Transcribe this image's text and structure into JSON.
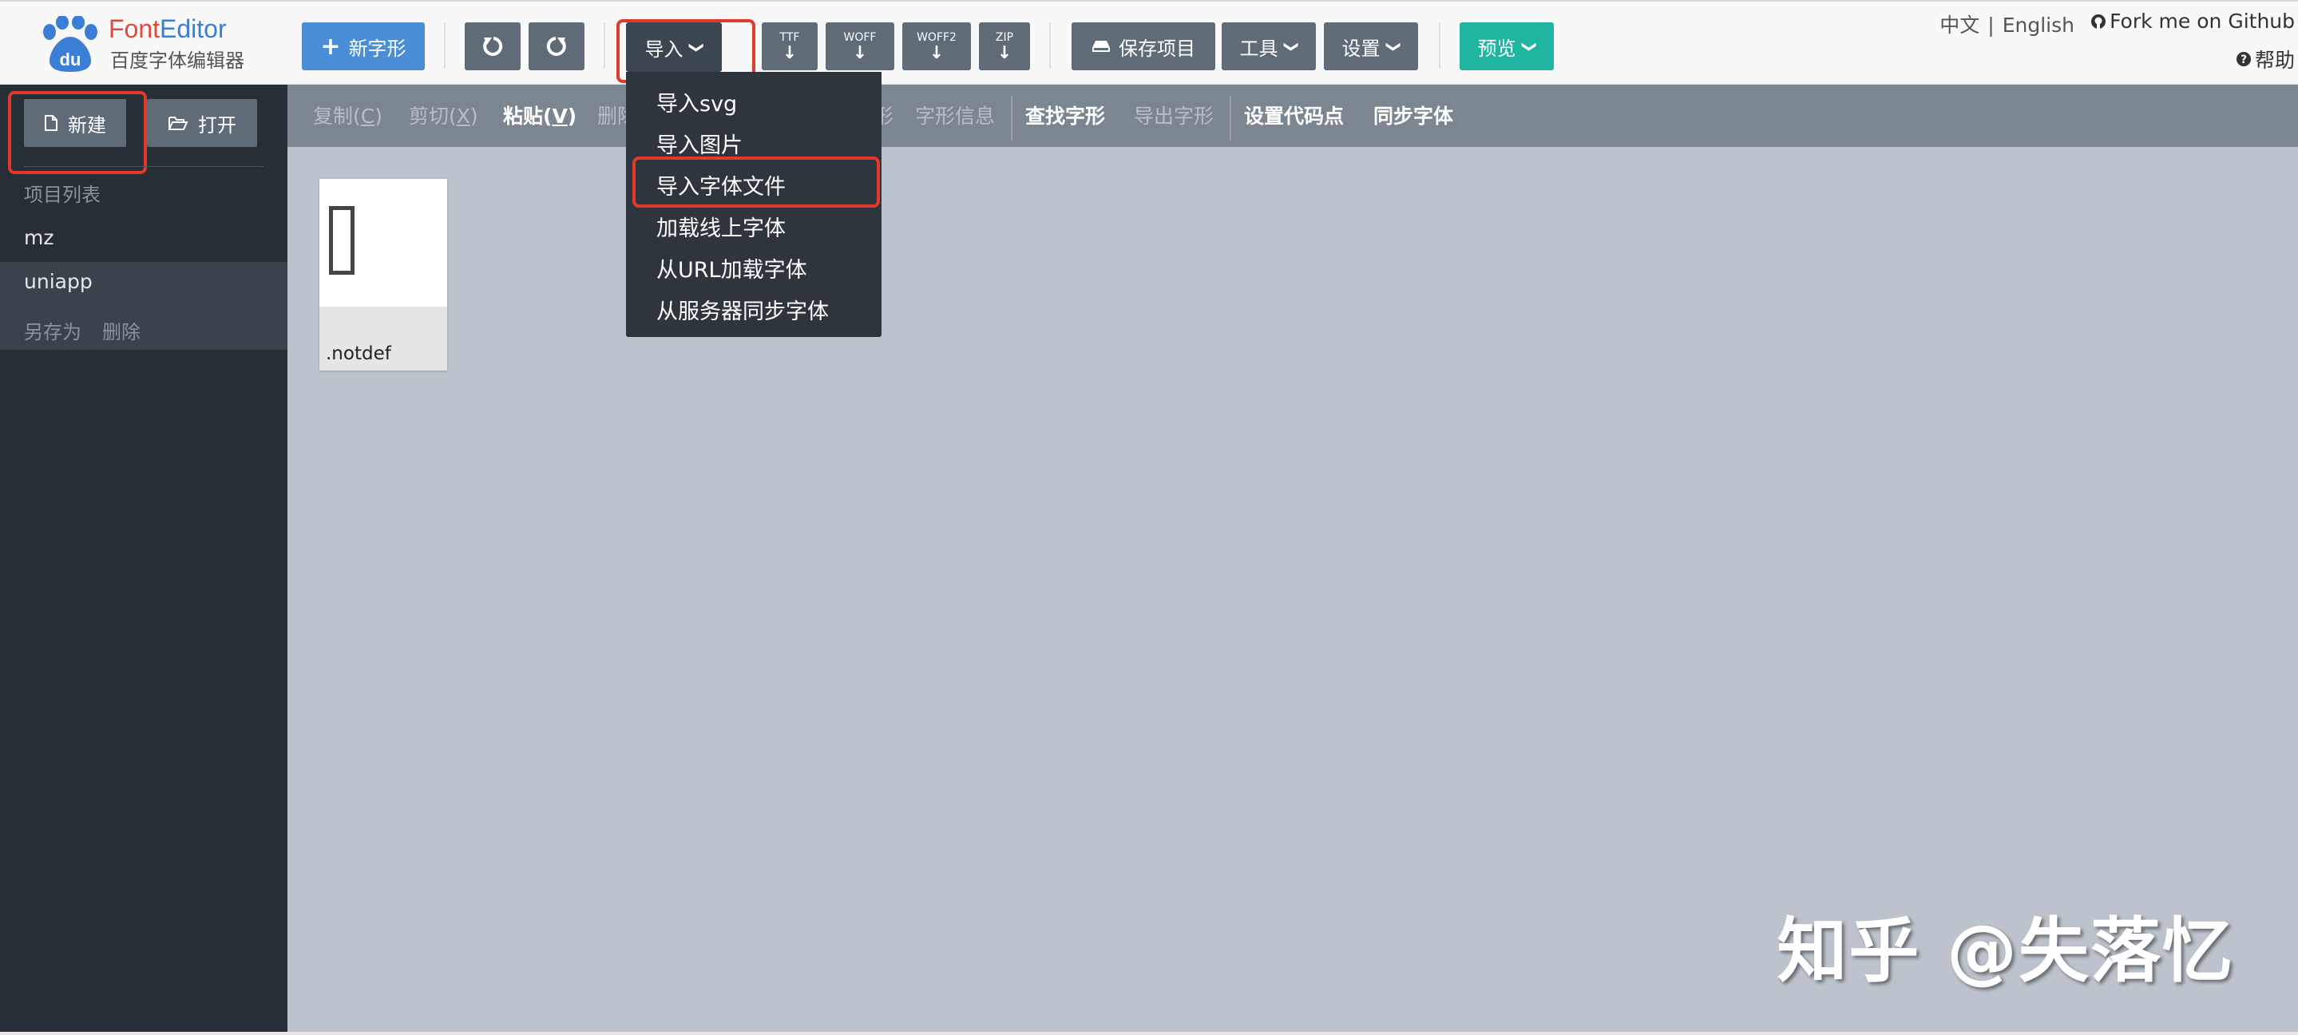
{
  "logo": {
    "title_font": "Font",
    "title_editor": "Editor",
    "subtitle": "百度字体编辑器",
    "badge": "du"
  },
  "toolbar": {
    "new_glyph": "新字形",
    "import": "导入",
    "ttf": "TTF",
    "woff": "WOFF",
    "woff2": "WOFF2",
    "zip": "ZIP",
    "save_project": "保存项目",
    "tools": "工具",
    "settings": "设置",
    "preview": "预览"
  },
  "lang": {
    "zh": "中文",
    "sep": "|",
    "en": "English"
  },
  "fork": "Fork me on Github",
  "help": "帮助",
  "sidebar": {
    "new": "新建",
    "open": "打开",
    "project_list_label": "项目列表",
    "projects": [
      {
        "name": "mz"
      },
      {
        "name": "uniapp"
      }
    ],
    "save_as": "另存为",
    "delete": "删除"
  },
  "edit_toolbar": {
    "copy": "复制(",
    "copy_key": "C",
    "copy_end": ")",
    "cut": "剪切(",
    "cut_key": "X",
    "cut_end": ")",
    "paste": "粘贴(",
    "paste_key": "V",
    "paste_end": ")",
    "delete_partial": "删除",
    "glyph_partial": "形",
    "glyph_info": "字形信息",
    "find_glyph": "查找字形",
    "export_glyph": "导出字形",
    "set_codepoint": "设置代码点",
    "sync_font": "同步字体"
  },
  "glyphs": [
    {
      "name": ".notdef",
      "char": ""
    }
  ],
  "import_menu": {
    "items": [
      "导入svg",
      "导入图片",
      "导入字体文件",
      "加载线上字体",
      "从URL加载字体",
      "从服务器同步字体"
    ],
    "highlighted": "导入字体文件"
  },
  "watermark": "知乎 @失落忆",
  "colors": {
    "primary": "#4a8ed8",
    "teal": "#1fb5a0",
    "highlight": "#e03a2a",
    "sidebar": "#272e36"
  }
}
